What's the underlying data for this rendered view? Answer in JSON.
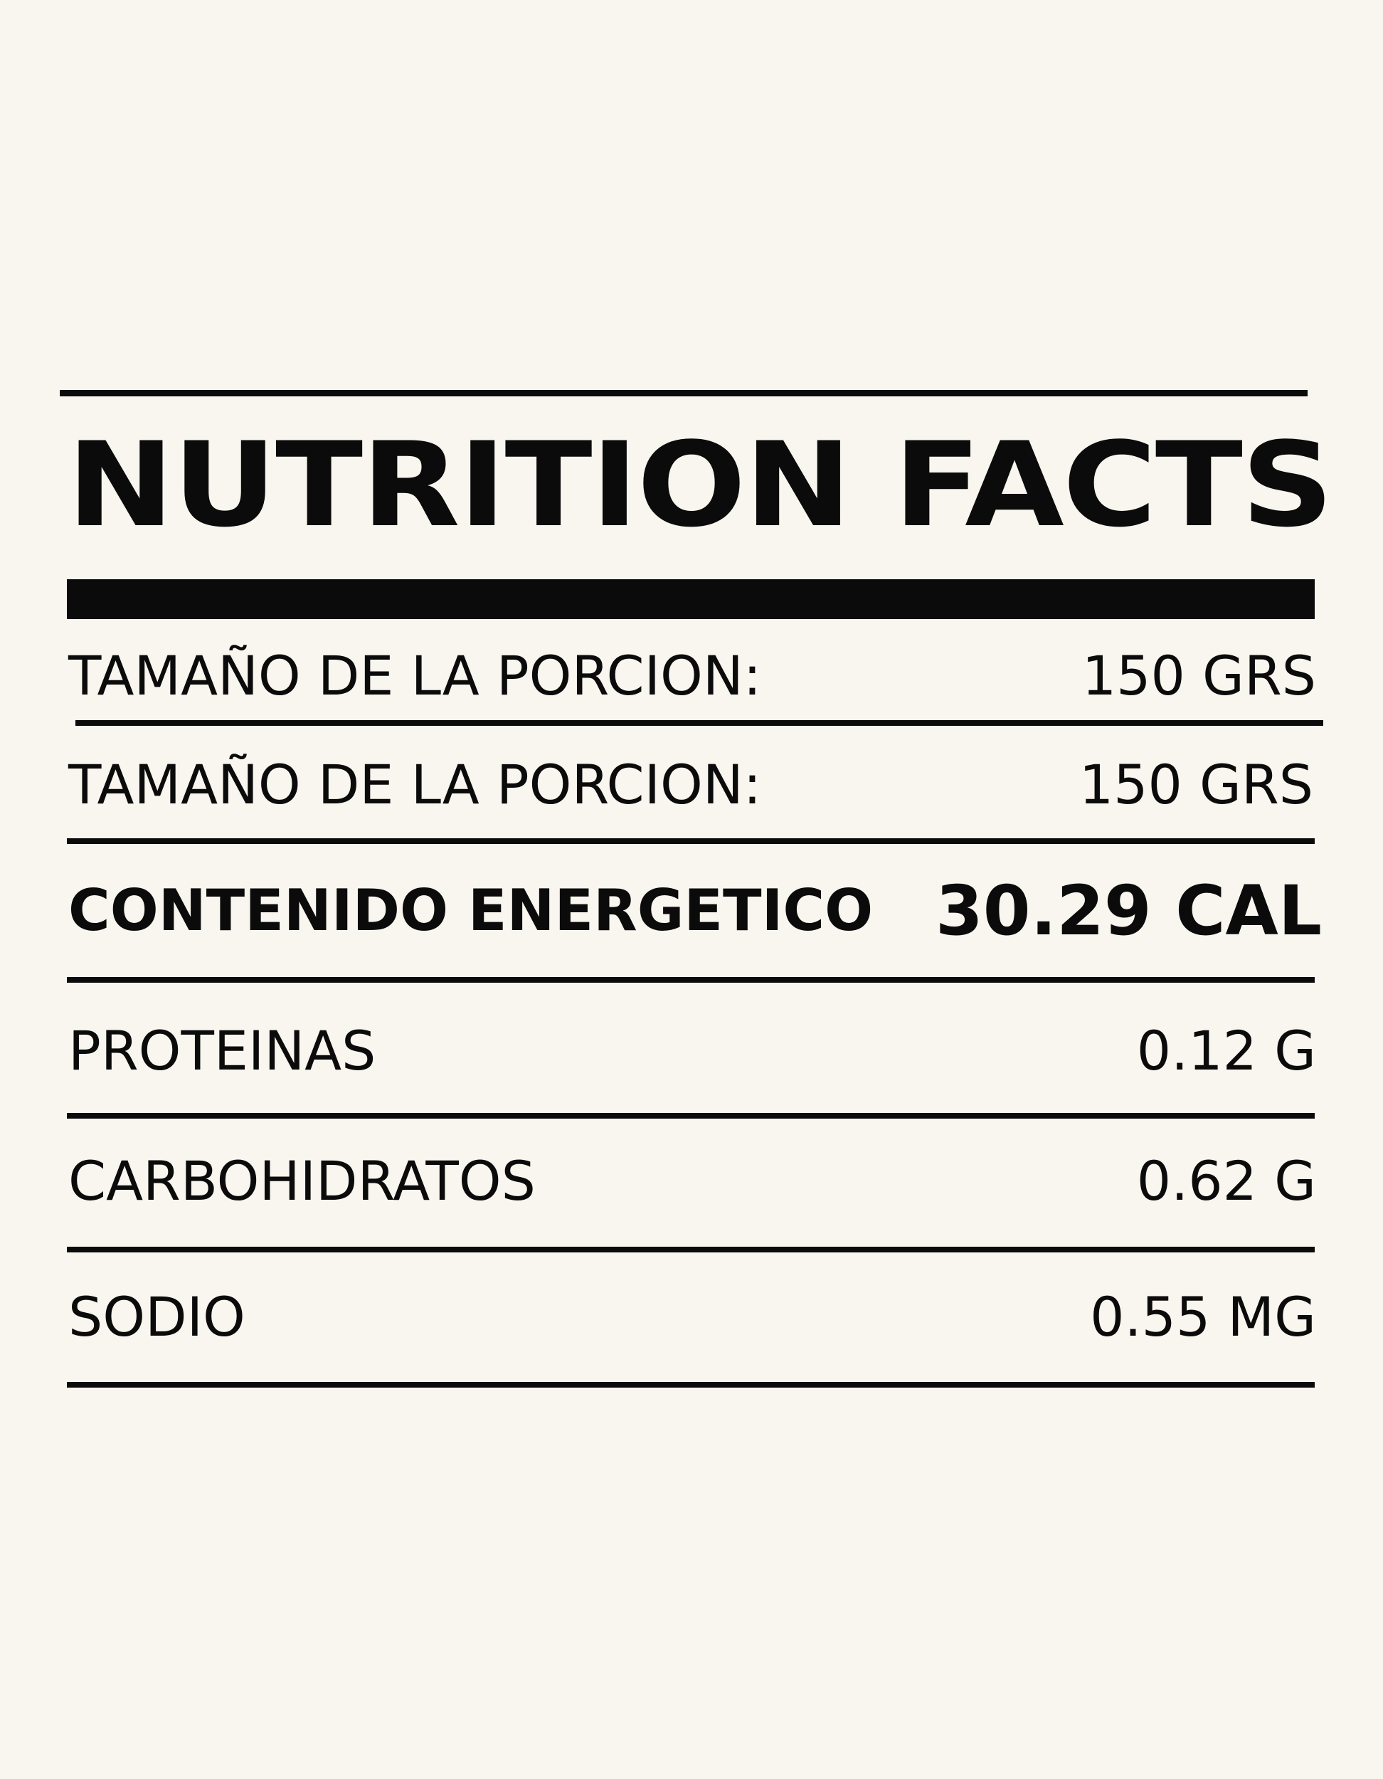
{
  "title": "NUTRITION FACTS",
  "rows": [
    {
      "label": "TAMAÑO DE LA PORCION:",
      "value": "150 GRS"
    },
    {
      "label": "TAMAÑO DE LA PORCION:",
      "value": "150 GRS"
    },
    {
      "label": "CONTENIDO ENERGETICO",
      "value": "30.29 CAL"
    },
    {
      "label": "PROTEINAS",
      "value": "0.12 G"
    },
    {
      "label": "CARBOHIDRATOS",
      "value": "0.62 G"
    },
    {
      "label": "SODIO",
      "value": "0.55 MG"
    }
  ],
  "colors": {
    "background": "#f9f6ef",
    "ink": "#0b0b0b"
  }
}
